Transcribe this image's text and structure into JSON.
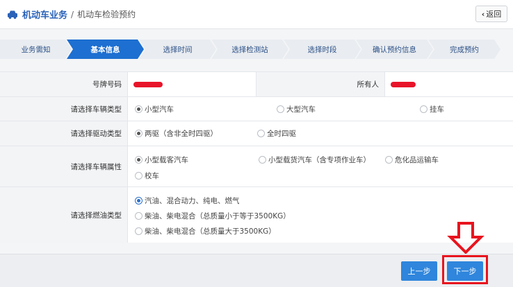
{
  "header": {
    "title": "机动车业务",
    "separator": "/",
    "crumb": "机动车检验预约",
    "back_label": "返回"
  },
  "steps": [
    "业务需知",
    "基本信息",
    "选择时间",
    "选择检测站",
    "选择时段",
    "确认预约信息",
    "完成预约"
  ],
  "form": {
    "plate_label": "号牌号码",
    "owner_label": "所有人",
    "vehicle_type_label": "请选择车辆类型",
    "vehicle_types": [
      "小型汽车",
      "大型汽车",
      "挂车"
    ],
    "drive_label": "请选择驱动类型",
    "drive_types": [
      "两驱（含非全时四驱）",
      "全时四驱"
    ],
    "attr_label": "请选择车辆属性",
    "attrs": [
      "小型载客汽车",
      "小型载货汽车（含专项作业车）",
      "危化品运输车",
      "校车"
    ],
    "fuel_label": "请选择燃油类型",
    "fuels": [
      "汽油、混合动力、纯电、燃气",
      "柴油、柴电混合（总质量小于等于3500KG）",
      "柴油、柴电混合（总质量大于3500KG）"
    ]
  },
  "footer": {
    "prev_label": "上一步",
    "next_label": "下一步"
  },
  "colors": {
    "accent": "#1d6fd1",
    "highlight": "#e8141e"
  }
}
